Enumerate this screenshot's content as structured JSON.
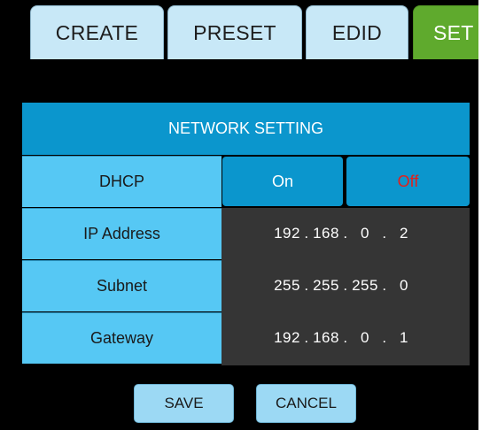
{
  "tabs": {
    "create": "CREATE",
    "preset": "PRESET",
    "edid": "EDID",
    "setting_partial": "SET"
  },
  "network": {
    "title": "NETWORK SETTING",
    "dhcp": {
      "label": "DHCP",
      "on_label": "On",
      "off_label": "Off",
      "selected": "Off"
    },
    "ip_address": {
      "label": "IP Address",
      "octets": [
        "192",
        "168",
        "0",
        "2"
      ]
    },
    "subnet": {
      "label": "Subnet",
      "octets": [
        "255",
        "255",
        "255",
        "0"
      ]
    },
    "gateway": {
      "label": "Gateway",
      "octets": [
        "192",
        "168",
        "0",
        "1"
      ]
    }
  },
  "actions": {
    "save_label": "SAVE",
    "cancel_label": "CANCEL"
  },
  "colors": {
    "tab_bg": "#c8e8f7",
    "tab_active_bg": "#5faa2d",
    "header_bg": "#0b96cd",
    "label_bg": "#56c8f4",
    "value_bg": "#353535",
    "off_text": "#e3201b"
  }
}
